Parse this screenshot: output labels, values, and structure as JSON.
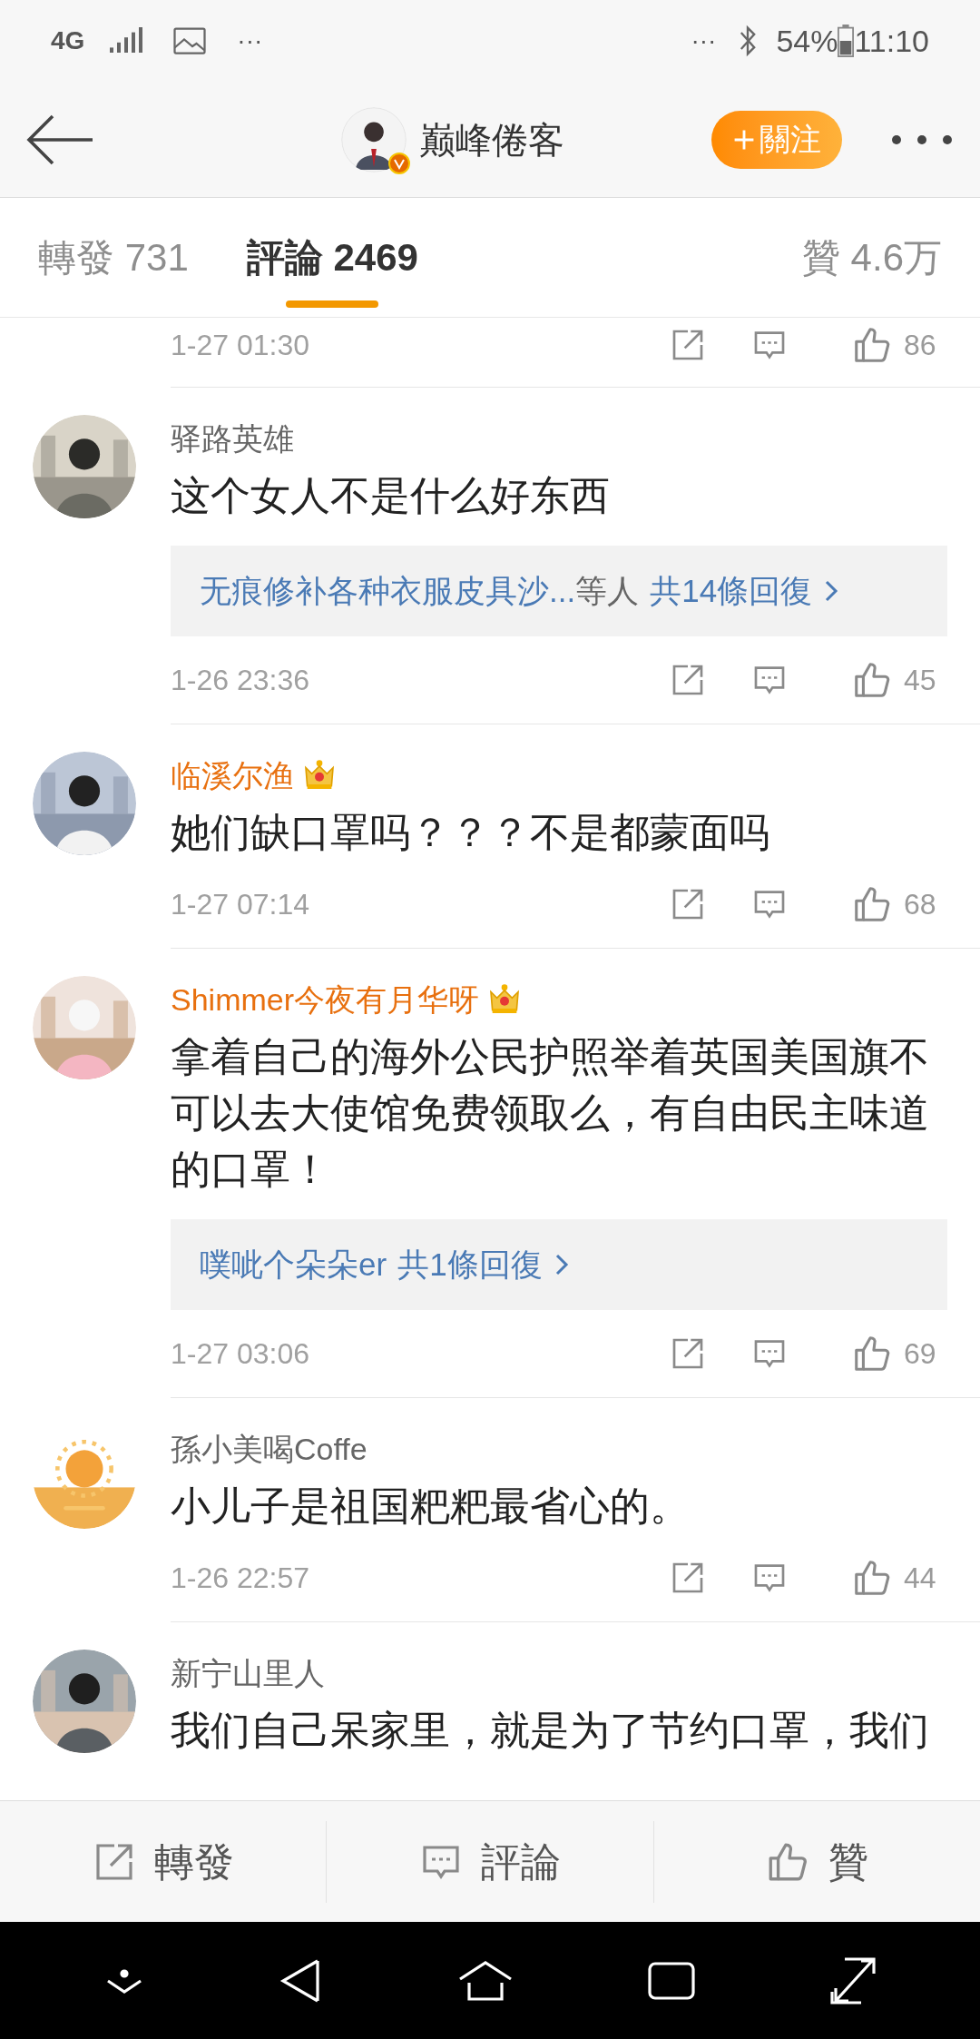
{
  "status_bar": {
    "network": "4G",
    "left_more": "···",
    "right_more": "···",
    "battery": "54%",
    "time": "11:10"
  },
  "header": {
    "title": "巅峰倦客",
    "follow_button": "關注"
  },
  "tabs": [
    {
      "label": "轉發 731",
      "selected": false
    },
    {
      "label": "評論 2469",
      "selected": true
    },
    {
      "label": "贊 4.6万",
      "selected": false
    }
  ],
  "partial_comment": {
    "date": "1-27 01:30",
    "likes": "86"
  },
  "comments": [
    {
      "name": "驿路英雄",
      "vip": false,
      "text": "这个女人不是什么好东西",
      "reply": {
        "names": "无痕修补各种衣服皮具沙...",
        "suffix": "等人",
        "count": "共14條回復"
      },
      "date": "1-26 23:36",
      "likes": "45"
    },
    {
      "name": "临溪尔渔",
      "vip": true,
      "text": "她们缺口罩吗？？？不是都蒙面吗",
      "date": "1-27 07:14",
      "likes": "68"
    },
    {
      "name": "Shimmer今夜有月华呀",
      "vip": true,
      "text": "拿着自己的海外公民护照举着英国美国旗不可以去大使馆免费领取么，有自由民主味道的口罩！",
      "reply": {
        "names": "噗呲个朵朵er",
        "count": "共1條回復"
      },
      "date": "1-27 03:06",
      "likes": "69"
    },
    {
      "name": "孫小美喝Coffe",
      "vip": false,
      "text": "小儿子是祖国粑粑最省心的。",
      "date": "1-26 22:57",
      "likes": "44"
    },
    {
      "name": "新宁山里人",
      "vip": false,
      "text": "我们自己呆家里，就是为了节约口罩，我们"
    }
  ],
  "bottom_bar": [
    "轉發",
    "評論",
    "贊"
  ]
}
